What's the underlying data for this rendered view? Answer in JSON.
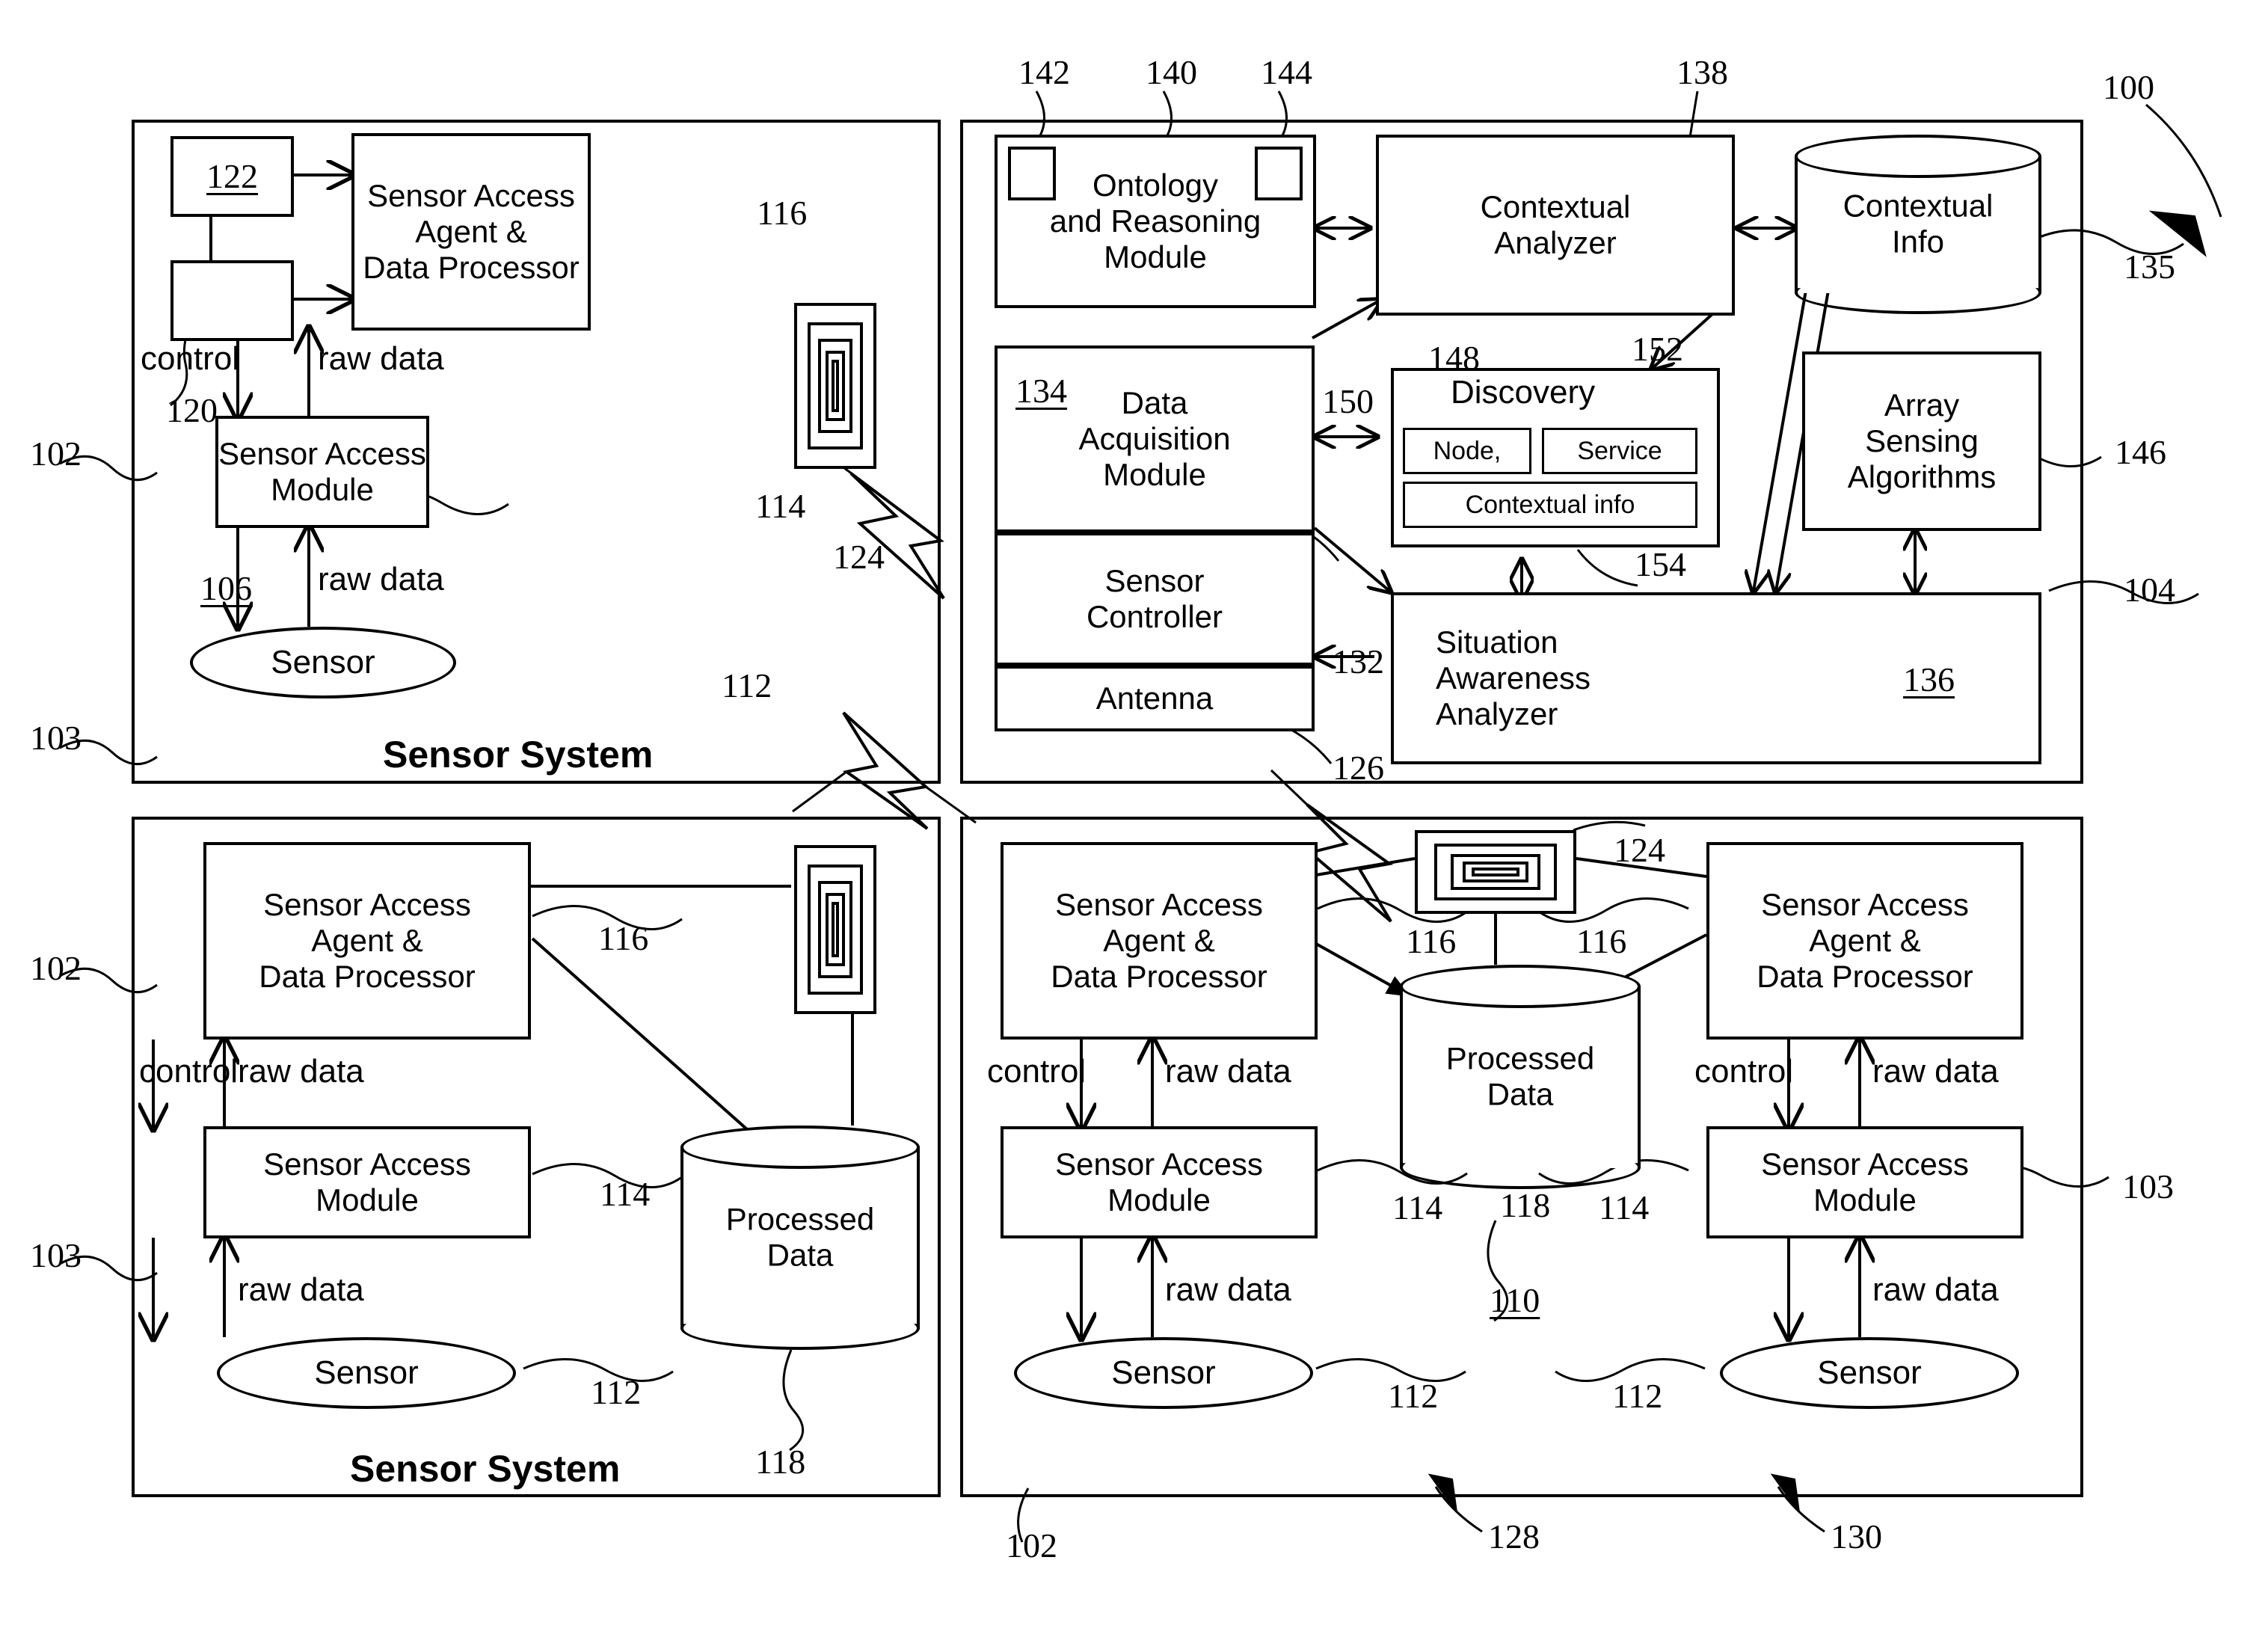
{
  "figure": {
    "ref_100": "100",
    "ref_102_a": "102",
    "ref_102_b": "102",
    "ref_102_c": "102",
    "ref_103_a": "103",
    "ref_103_b": "103",
    "ref_103_c": "103",
    "ref_104": "104",
    "ref_106": "106",
    "ref_110": "110",
    "ref_112_a": "112",
    "ref_112_b": "112",
    "ref_112_c": "112",
    "ref_112_d": "112",
    "ref_114_a": "114",
    "ref_114_b": "114",
    "ref_114_c": "114",
    "ref_114_d": "114",
    "ref_116_a": "116",
    "ref_116_b": "116",
    "ref_116_c": "116",
    "ref_116_d": "116",
    "ref_118_a": "118",
    "ref_118_b": "118",
    "ref_120": "120",
    "ref_122": "122",
    "ref_124_a": "124",
    "ref_124_b": "124",
    "ref_126": "126",
    "ref_128": "128",
    "ref_130": "130",
    "ref_132": "132",
    "ref_134": "134",
    "ref_135": "135",
    "ref_136": "136",
    "ref_138": "138",
    "ref_140": "140",
    "ref_142": "142",
    "ref_144": "144",
    "ref_146": "146",
    "ref_148": "148",
    "ref_150": "150",
    "ref_152": "152",
    "ref_154": "154"
  },
  "panel_top_left": {
    "title": "Sensor System",
    "agent_box": "Sensor Access\nAgent &\nData Processor",
    "access_module": "Sensor Access\nModule",
    "sensor": "Sensor",
    "control_label": "control",
    "raw_data_upper": "raw data",
    "raw_data_lower": "raw data",
    "box_122_label": "122",
    "box_120_label": ""
  },
  "panel_bottom_left": {
    "title": "Sensor System",
    "agent_box": "Sensor Access\nAgent &\nData Processor",
    "access_module": "Sensor Access\nModule",
    "sensor": "Sensor",
    "control_label": "control",
    "raw_data_upper": "raw data",
    "raw_data_lower": "raw data",
    "processed_data": "Processed\nData"
  },
  "panel_center": {
    "ontology_module": "Ontology\nand Reasoning\nModule",
    "contextual_analyzer": "Contextual\nAnalyzer",
    "contextual_info": "Contextual\nInfo",
    "data_acquisition_module": "Data\nAcquisition\nModule",
    "sensor_controller": "Sensor\nController",
    "antenna": "Antenna",
    "discovery_title": "Discovery",
    "discovery_node": "Node,",
    "discovery_service": "Service",
    "discovery_contextual_info": "Contextual info",
    "array_sensing_algorithms": "Array\nSensing\nAlgorithms",
    "situation_awareness_analyzer": "Situation\nAwareness\nAnalyzer"
  },
  "panel_bottom_right": {
    "left_node": {
      "agent_box": "Sensor Access\nAgent &\nData Processor",
      "access_module": "Sensor Access\nModule",
      "sensor": "Sensor",
      "control_label": "control",
      "raw_data_upper": "raw data",
      "raw_data_lower": "raw data"
    },
    "right_node": {
      "agent_box": "Sensor Access\nAgent &\nData Processor",
      "access_module": "Sensor Access\nModule",
      "sensor": "Sensor",
      "control_label": "control",
      "raw_data_upper": "raw data",
      "raw_data_lower": "raw data"
    },
    "processed_data": "Processed\nData"
  },
  "colors": {
    "ink": "#000000",
    "paper": "#ffffff"
  }
}
